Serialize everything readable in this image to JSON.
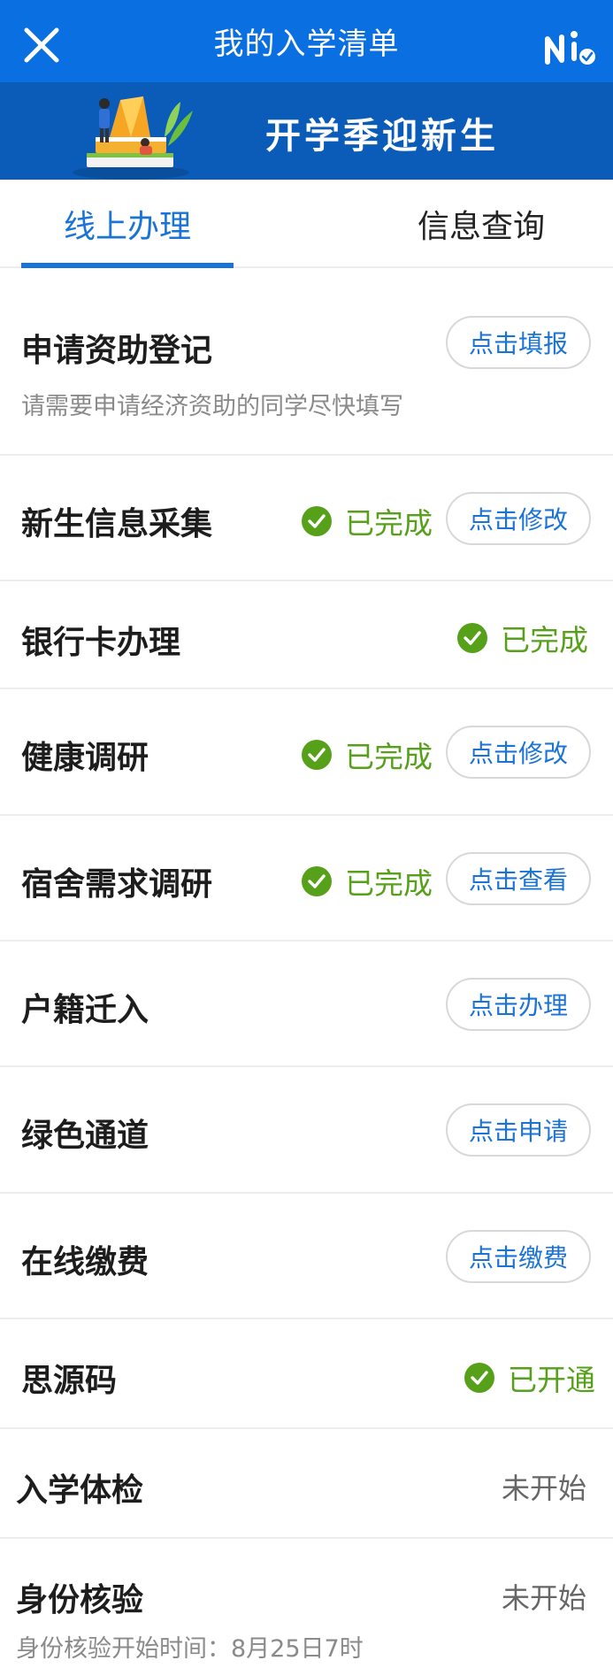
{
  "header": {
    "title": "我的入学清单"
  },
  "banner": {
    "text": "开学季迎新生"
  },
  "tabs": [
    {
      "label": "线上办理"
    },
    {
      "label": "信息查询"
    }
  ],
  "items": [
    {
      "title": "申请资助登记",
      "subtitle": "请需要申请经济资助的同学尽快填写",
      "action": "点击填报"
    },
    {
      "title": "新生信息采集",
      "status": "已完成",
      "action": "点击修改"
    },
    {
      "title": "银行卡办理",
      "status": "已完成"
    },
    {
      "title": "健康调研",
      "status": "已完成",
      "action": "点击修改"
    },
    {
      "title": "宿舍需求调研",
      "status": "已完成",
      "action": "点击查看"
    },
    {
      "title": "户籍迁入",
      "action": "点击办理"
    },
    {
      "title": "绿色通道",
      "action": "点击申请"
    },
    {
      "title": "在线缴费",
      "action": "点击缴费"
    },
    {
      "title": "思源码",
      "status": "已开通"
    },
    {
      "title": "入学体检",
      "status": "未开始"
    },
    {
      "title": "身份核验",
      "status": "未开始",
      "subtitle": "身份核验开始时间：8月25日7时"
    }
  ],
  "colors": {
    "primary": "#0a6fe0",
    "banner": "#0a5cb8",
    "success": "#56a01a",
    "link": "#1a73d6"
  }
}
